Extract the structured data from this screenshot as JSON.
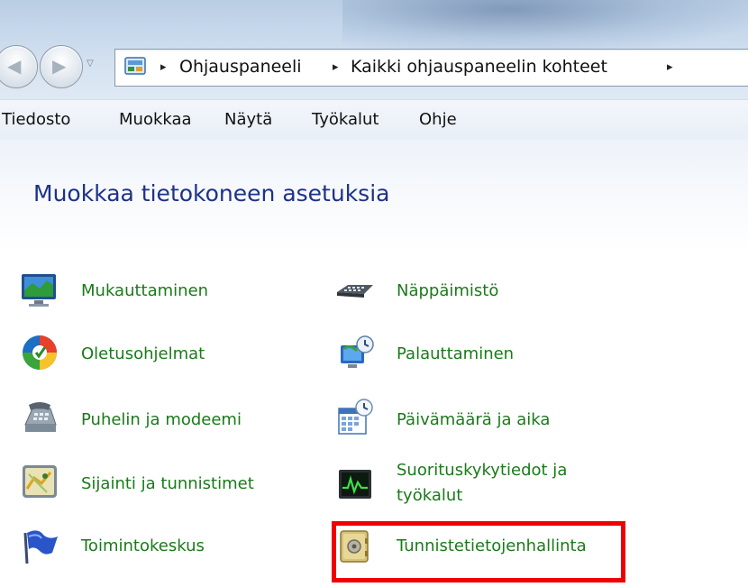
{
  "address_bar": {
    "crumbs": [
      "Ohjauspaneeli",
      "Kaikki ohjauspaneelin kohteet"
    ],
    "separator": "▸"
  },
  "menu": {
    "items": [
      "Tiedosto",
      "Muokkaa",
      "Näytä",
      "Työkalut",
      "Ohje"
    ]
  },
  "page_title": "Muokkaa tietokoneen asetuksia",
  "items": [
    {
      "label": "Mukauttaminen",
      "icon": "personalization-icon"
    },
    {
      "label": "Näppäimistö",
      "icon": "keyboard-icon"
    },
    {
      "label": "Oletusohjelmat",
      "icon": "default-programs-icon"
    },
    {
      "label": "Palauttaminen",
      "icon": "recovery-icon"
    },
    {
      "label": "Puhelin ja modeemi",
      "icon": "phone-modem-icon"
    },
    {
      "label": "Päivämäärä ja aika",
      "icon": "date-time-icon"
    },
    {
      "label": "Sijainti ja tunnistimet",
      "icon": "location-sensors-icon"
    },
    {
      "label_line1": "Suorituskykytiedot ja",
      "label_line2": "työkalut",
      "icon": "performance-icon"
    },
    {
      "label": "Toimintokeskus",
      "icon": "action-center-flag-icon"
    },
    {
      "label": "Tunnistetietojenhallinta",
      "icon": "credential-manager-vault-icon"
    }
  ],
  "highlight": {
    "target": "Tunnistetietojenhallinta",
    "color": "#f00000"
  },
  "colors": {
    "title": "#1e3287",
    "link": "#1a7a1a"
  }
}
